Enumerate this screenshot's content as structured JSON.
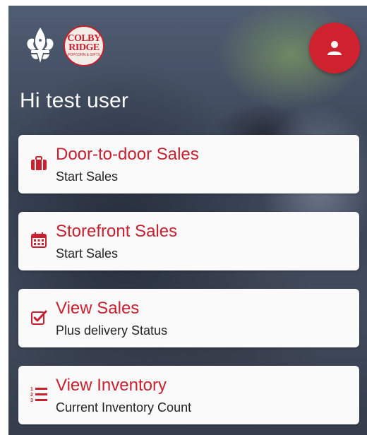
{
  "header": {
    "logo_primary_icon": "scouts-fleur-de-lis-icon",
    "logo_partner": {
      "line1": "COLBY",
      "line2": "RIDGE",
      "tagline": "POPCORN & GIFTS"
    },
    "avatar_icon": "user-icon"
  },
  "greeting": "Hi test user",
  "menu": [
    {
      "title": "Door-to-door Sales",
      "subtitle": "Start Sales",
      "icon": "briefcase-icon"
    },
    {
      "title": "Storefront Sales",
      "subtitle": "Start Sales",
      "icon": "calendar-icon"
    },
    {
      "title": "View Sales",
      "subtitle": "Plus delivery Status",
      "icon": "checkbox-icon"
    },
    {
      "title": "View Inventory",
      "subtitle": "Current Inventory Count",
      "icon": "numbered-list-icon"
    }
  ],
  "colors": {
    "accent": "#c8202f",
    "avatar": "#d0212f",
    "card": "#fafafa"
  }
}
